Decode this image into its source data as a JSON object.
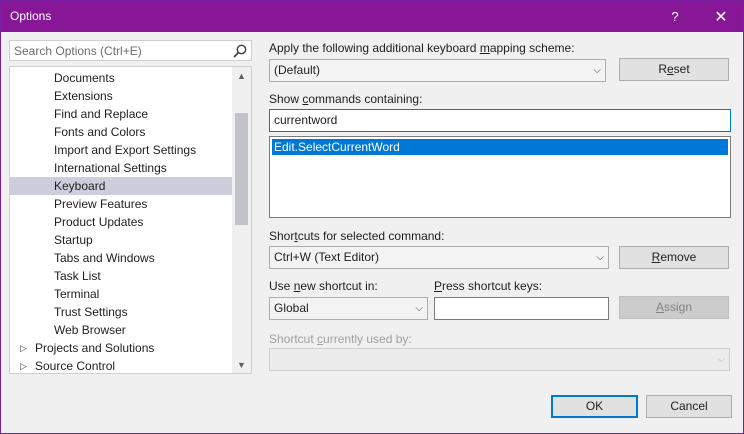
{
  "window": {
    "title": "Options",
    "help_glyph": "?",
    "close_glyph": "✕"
  },
  "search": {
    "placeholder": "Search Options (Ctrl+E)"
  },
  "tree": {
    "items": [
      {
        "label": "Documents",
        "level": 2
      },
      {
        "label": "Extensions",
        "level": 2
      },
      {
        "label": "Find and Replace",
        "level": 2
      },
      {
        "label": "Fonts and Colors",
        "level": 2
      },
      {
        "label": "Import and Export Settings",
        "level": 2
      },
      {
        "label": "International Settings",
        "level": 2
      },
      {
        "label": "Keyboard",
        "level": 2,
        "selected": true
      },
      {
        "label": "Preview Features",
        "level": 2
      },
      {
        "label": "Product Updates",
        "level": 2
      },
      {
        "label": "Startup",
        "level": 2
      },
      {
        "label": "Tabs and Windows",
        "level": 2
      },
      {
        "label": "Task List",
        "level": 2
      },
      {
        "label": "Terminal",
        "level": 2
      },
      {
        "label": "Trust Settings",
        "level": 2
      },
      {
        "label": "Web Browser",
        "level": 2
      },
      {
        "label": "Projects and Solutions",
        "level": 1,
        "expander": "▷"
      },
      {
        "label": "Source Control",
        "level": 1,
        "expander": "▷"
      }
    ],
    "scroll_up": "▲",
    "scroll_down": "▼"
  },
  "keyboard": {
    "mapping_label_pre": "Apply the following additional keyboard ",
    "mapping_label_u": "m",
    "mapping_label_post": "apping scheme:",
    "mapping_value": "(Default)",
    "reset_pre": "R",
    "reset_u": "e",
    "reset_post": "set",
    "show_label_pre": "Show ",
    "show_label_u": "c",
    "show_label_post": "ommands containing:",
    "show_value": "currentword",
    "commands": [
      "Edit.SelectCurrentWord"
    ],
    "shortcuts_label_pre": "Shor",
    "shortcuts_label_u": "t",
    "shortcuts_label_post": "cuts for selected command:",
    "shortcuts_value": "Ctrl+W (Text Editor)",
    "remove_pre": "",
    "remove_u": "R",
    "remove_post": "emove",
    "use_label_pre": "Use ",
    "use_label_u": "n",
    "use_label_post": "ew shortcut in:",
    "use_value": "Global",
    "press_label_pre": "",
    "press_label_u": "P",
    "press_label_post": "ress shortcut keys:",
    "press_value": "",
    "assign_pre": "",
    "assign_u": "A",
    "assign_post": "ssign",
    "used_label_pre": "Shortcut ",
    "used_label_u": "c",
    "used_label_post": "urrently used by:",
    "used_value": "",
    "chevron": "⌵"
  },
  "footer": {
    "ok_label": "OK",
    "cancel_label": "Cancel"
  },
  "colors": {
    "titlebar": "#881798",
    "selection": "#0078d7",
    "tree_selection": "#cccedb"
  }
}
